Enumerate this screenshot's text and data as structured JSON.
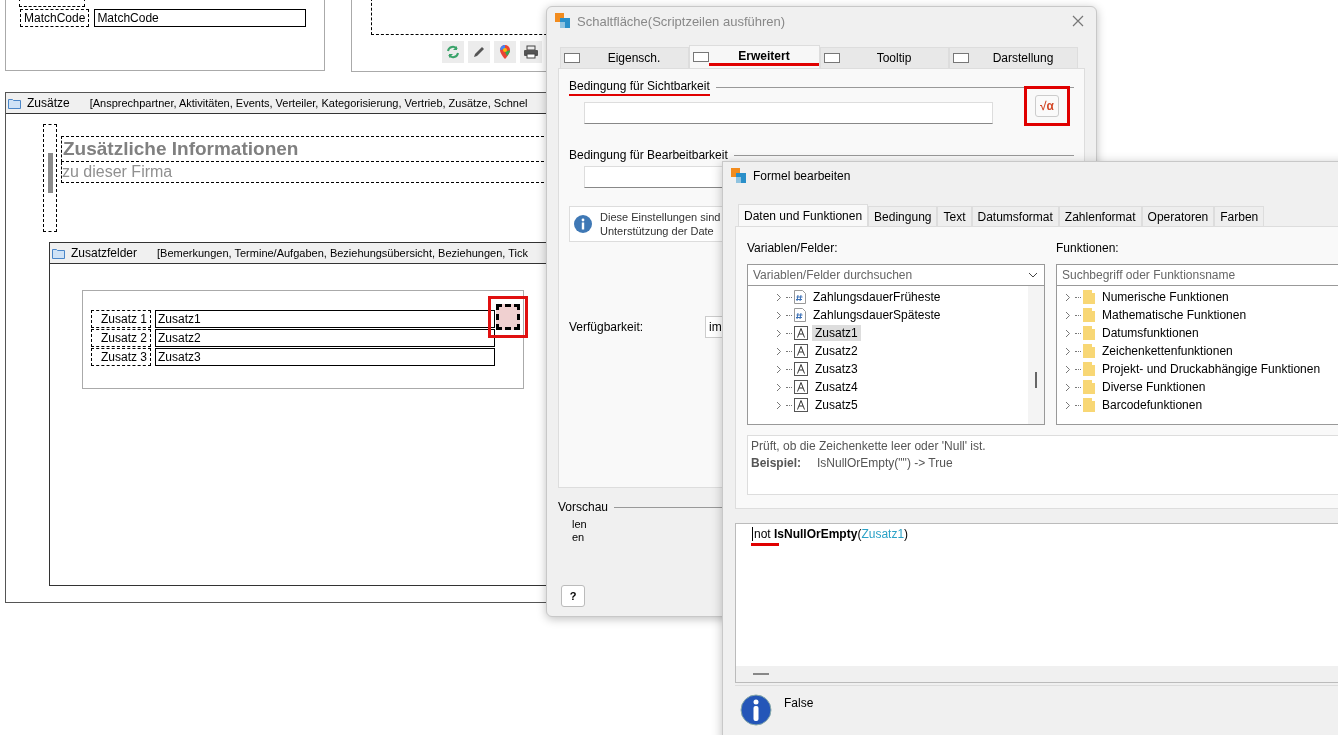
{
  "designer": {
    "match_label": "MatchCode",
    "match_value": "MatchCode",
    "section": {
      "title": "Zusätze",
      "tab_list": "[Ansprechpartner, Aktivitäten, Events, Verteiler, Kategorisierung, Vertrieb, Zusätze, Schnel"
    },
    "heading": "Zusätzliche Informationen",
    "subheading": "zu dieser Firma",
    "subsection": {
      "title": "Zusatzfelder",
      "tab_list": "[Bemerkungen, Termine/Aufgaben, Beziehungsübersicht, Beziehungen, Tick"
    },
    "fields": [
      {
        "label": "Zusatz 1",
        "value": "Zusatz1"
      },
      {
        "label": "Zusatz 2",
        "value": "Zusatz2"
      },
      {
        "label": "Zusatz 3",
        "value": "Zusatz3"
      }
    ]
  },
  "button_dialog": {
    "title": "Schaltfläche(Scriptzeilen ausführen)",
    "tabs": [
      {
        "label": "Eigensch.",
        "selected": false
      },
      {
        "label": "Erweitert",
        "selected": true
      },
      {
        "label": "Tooltip",
        "selected": false
      },
      {
        "label": "Darstellung",
        "selected": false
      }
    ],
    "visibility_label": "Bedingung für Sichtbarkeit",
    "formula_button": "√α",
    "edit_label": "Bedingung für Bearbeitbarkeit",
    "info_lines": [
      "Diese Einstellungen sind",
      "Unterstützung der Date"
    ],
    "availability_label": "Verfügbarkeit:",
    "availability_value": "im",
    "preview_label": "Vorschau",
    "preview_lines": [
      "len",
      "en"
    ],
    "help_button": "?"
  },
  "formula_dialog": {
    "title": "Formel bearbeiten",
    "tabs": [
      {
        "label": "Daten und Funktionen",
        "selected": true
      },
      {
        "label": "Bedingung",
        "selected": false
      },
      {
        "label": "Text",
        "selected": false
      },
      {
        "label": "Datumsformat",
        "selected": false
      },
      {
        "label": "Zahlenformat",
        "selected": false
      },
      {
        "label": "Operatoren",
        "selected": false
      },
      {
        "label": "Farben",
        "selected": false
      }
    ],
    "variables_label": "Variablen/Felder:",
    "variables_search": {
      "placeholder": "Variablen/Felder durchsuchen"
    },
    "variables": [
      {
        "label": "ZahlungsdauerFrüheste",
        "kind": "number",
        "selected": false
      },
      {
        "label": "ZahlungsdauerSpäteste",
        "kind": "number",
        "selected": false
      },
      {
        "label": "Zusatz1",
        "kind": "text",
        "selected": true
      },
      {
        "label": "Zusatz2",
        "kind": "text",
        "selected": false
      },
      {
        "label": "Zusatz3",
        "kind": "text",
        "selected": false
      },
      {
        "label": "Zusatz4",
        "kind": "text",
        "selected": false
      },
      {
        "label": "Zusatz5",
        "kind": "text",
        "selected": false
      }
    ],
    "functions_label": "Funktionen:",
    "functions_search": {
      "placeholder": "Suchbegriff oder Funktionsname"
    },
    "functions": [
      "Numerische Funktionen",
      "Mathematische Funktionen",
      "Datumsfunktionen",
      "Zeichenkettenfunktionen",
      "Projekt- und Druckabhängige Funktionen",
      "Diverse Funktionen",
      "Barcodefunktionen"
    ],
    "description": "Prüft, ob die Zeichenkette leer oder 'Null' ist.",
    "example_label": "Beispiel:",
    "example": "IsNullOrEmpty(\"\") -> True",
    "formula": [
      {
        "text": "not",
        "kind": "keyword"
      },
      {
        "text": "IsNullOrEmpty",
        "kind": "function"
      },
      {
        "text": "(",
        "kind": "punct"
      },
      {
        "text": "Zusatz1",
        "kind": "field"
      },
      {
        "text": ")",
        "kind": "punct"
      }
    ],
    "result": "False"
  }
}
